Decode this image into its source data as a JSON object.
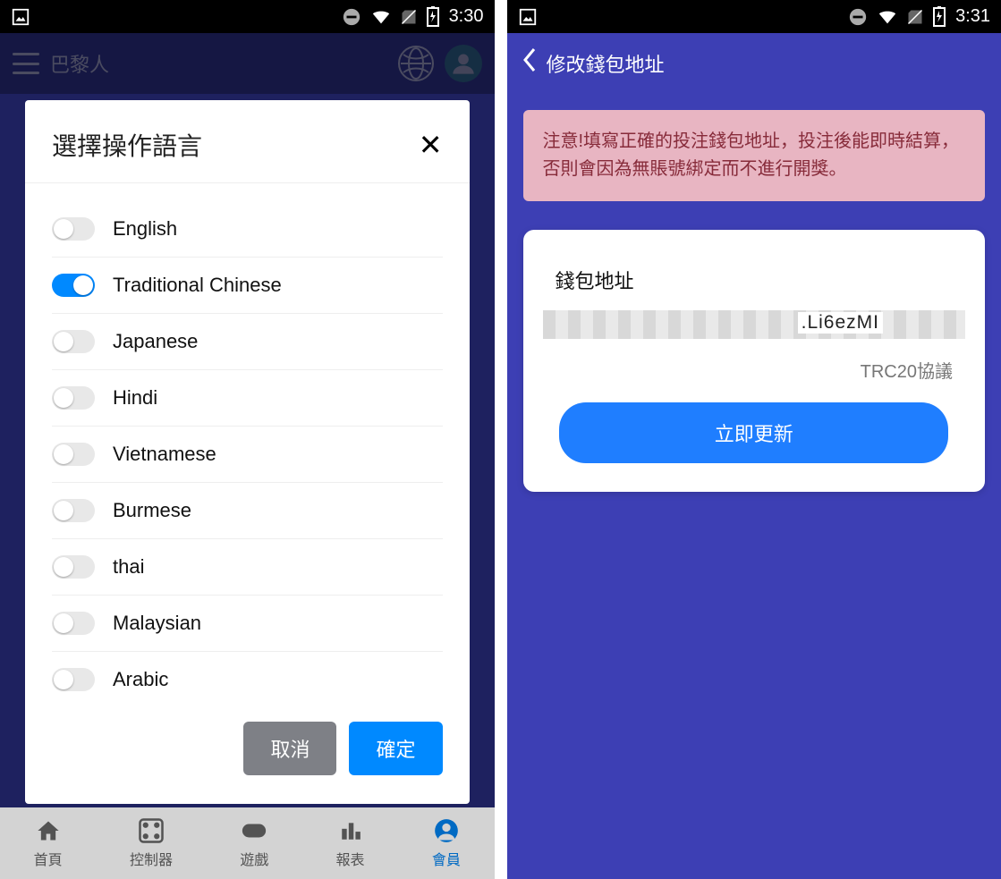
{
  "phone1": {
    "status_time": "3:30",
    "brand": "巴黎人",
    "modal": {
      "title": "選擇操作語言",
      "languages": [
        {
          "label": "English",
          "on": false
        },
        {
          "label": "Traditional Chinese",
          "on": true
        },
        {
          "label": "Japanese",
          "on": false
        },
        {
          "label": "Hindi",
          "on": false
        },
        {
          "label": "Vietnamese",
          "on": false
        },
        {
          "label": "Burmese",
          "on": false
        },
        {
          "label": "thai",
          "on": false
        },
        {
          "label": "Malaysian",
          "on": false
        },
        {
          "label": "Arabic",
          "on": false
        }
      ],
      "cancel_label": "取消",
      "confirm_label": "確定"
    },
    "nav": [
      {
        "label": "首頁",
        "icon": "home",
        "active": false
      },
      {
        "label": "控制器",
        "icon": "dpad",
        "active": false
      },
      {
        "label": "遊戲",
        "icon": "gamepad",
        "active": false
      },
      {
        "label": "報表",
        "icon": "chart",
        "active": false
      },
      {
        "label": "會員",
        "icon": "person",
        "active": true
      }
    ]
  },
  "phone2": {
    "status_time": "3:31",
    "page_title": "修改錢包地址",
    "warning": "注意!填寫正確的投注錢包地址，投注後能即時結算，否則會因為無賬號綁定而不進行開獎。",
    "card": {
      "label": "錢包地址",
      "address_partial": ".Li6ezMI",
      "protocol": "TRC20協議",
      "update_button": "立即更新"
    }
  }
}
